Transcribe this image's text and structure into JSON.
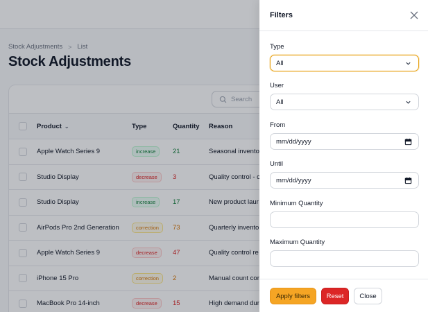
{
  "breadcrumb": {
    "parent": "Stock Adjustments",
    "separator": ">",
    "current": "List"
  },
  "page": {
    "title": "Stock Adjustments"
  },
  "search": {
    "placeholder": "Search"
  },
  "table": {
    "columns": {
      "product": "Product",
      "type": "Type",
      "quantity": "Quantity",
      "reason": "Reason"
    },
    "rows": [
      {
        "product": "Apple Watch Series 9",
        "type": "increase",
        "quantity": "21",
        "reason": "Seasonal invento"
      },
      {
        "product": "Studio Display",
        "type": "decrease",
        "quantity": "3",
        "reason": "Quality control - c"
      },
      {
        "product": "Studio Display",
        "type": "increase",
        "quantity": "17",
        "reason": "New product laur"
      },
      {
        "product": "AirPods Pro 2nd Generation",
        "type": "correction",
        "quantity": "73",
        "reason": "Quarterly invento"
      },
      {
        "product": "Apple Watch Series 9",
        "type": "decrease",
        "quantity": "47",
        "reason": "Quality control re"
      },
      {
        "product": "iPhone 15 Pro",
        "type": "correction",
        "quantity": "2",
        "reason": "Manual count cor"
      },
      {
        "product": "MacBook Pro 14-inch",
        "type": "decrease",
        "quantity": "15",
        "reason": "High demand dur"
      }
    ]
  },
  "filters": {
    "title": "Filters",
    "type_label": "Type",
    "type_value": "All",
    "user_label": "User",
    "user_value": "All",
    "from_label": "From",
    "from_placeholder": "mm/dd/yyyy",
    "until_label": "Until",
    "until_placeholder": "mm/dd/yyyy",
    "min_qty_label": "Minimum Quantity",
    "min_qty_value": "",
    "max_qty_label": "Maximum Quantity",
    "max_qty_value": "",
    "apply_label": "Apply filters",
    "reset_label": "Reset",
    "close_label": "Close"
  },
  "colors": {
    "accent": "#f5a524",
    "danger": "#dc2626",
    "increase": "#15803d",
    "decrease": "#dc2626",
    "correction": "#d97706"
  }
}
